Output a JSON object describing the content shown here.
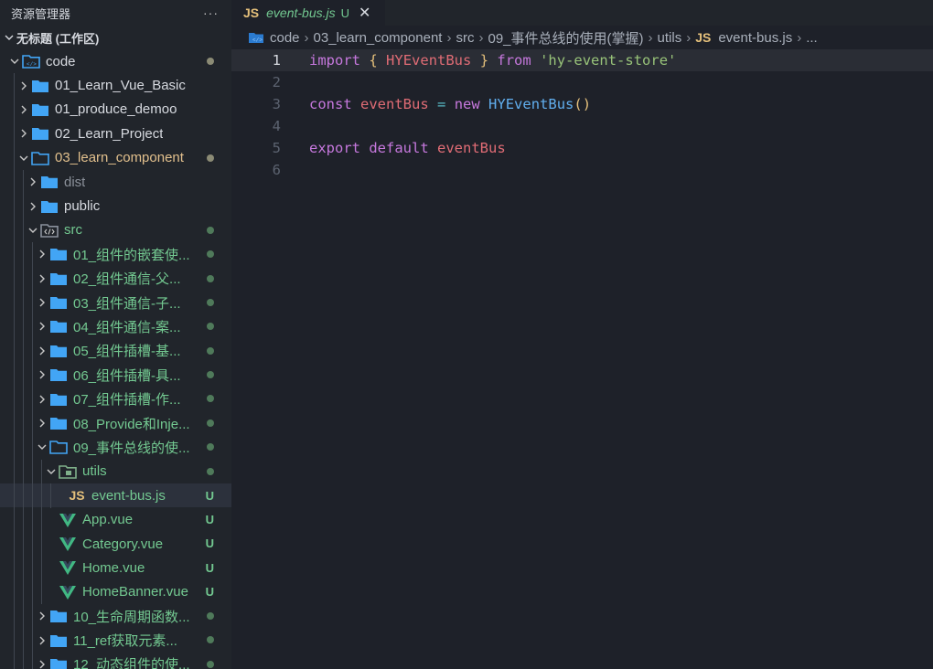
{
  "explorer": {
    "title": "资源管理器",
    "more": "···",
    "workspace": "无标题 (工作区)",
    "rows": [
      {
        "label": "code",
        "depth": 0,
        "open": true,
        "icon": "root",
        "color": "#d7dae0",
        "deco": "dot-gray"
      },
      {
        "label": "01_Learn_Vue_Basic",
        "depth": 1,
        "open": false,
        "icon": "folder",
        "color": "#d7dae0",
        "deco": ""
      },
      {
        "label": "01_produce_demoo",
        "depth": 1,
        "open": false,
        "icon": "folder",
        "color": "#d7dae0",
        "deco": ""
      },
      {
        "label": "02_Learn_Project",
        "depth": 1,
        "open": false,
        "icon": "folder",
        "color": "#d7dae0",
        "deco": ""
      },
      {
        "label": "03_learn_component",
        "depth": 1,
        "open": true,
        "icon": "folder-open",
        "color": "#e2c08d",
        "deco": "dot-gray"
      },
      {
        "label": "dist",
        "depth": 2,
        "open": false,
        "icon": "folder",
        "color": "#8b919a",
        "deco": ""
      },
      {
        "label": "public",
        "depth": 2,
        "open": false,
        "icon": "folder",
        "color": "#d7dae0",
        "deco": ""
      },
      {
        "label": "src",
        "depth": 2,
        "open": true,
        "icon": "src",
        "color": "#73c991",
        "deco": "dot-green"
      },
      {
        "label": "01_组件的嵌套使...",
        "depth": 3,
        "open": false,
        "icon": "folder",
        "color": "#73c991",
        "deco": "dot-green"
      },
      {
        "label": "02_组件通信-父...",
        "depth": 3,
        "open": false,
        "icon": "folder",
        "color": "#73c991",
        "deco": "dot-green"
      },
      {
        "label": "03_组件通信-子...",
        "depth": 3,
        "open": false,
        "icon": "folder",
        "color": "#73c991",
        "deco": "dot-green"
      },
      {
        "label": "04_组件通信-案...",
        "depth": 3,
        "open": false,
        "icon": "folder",
        "color": "#73c991",
        "deco": "dot-green"
      },
      {
        "label": "05_组件插槽-基...",
        "depth": 3,
        "open": false,
        "icon": "folder",
        "color": "#73c991",
        "deco": "dot-green"
      },
      {
        "label": "06_组件插槽-具...",
        "depth": 3,
        "open": false,
        "icon": "folder",
        "color": "#73c991",
        "deco": "dot-green"
      },
      {
        "label": "07_组件插槽-作...",
        "depth": 3,
        "open": false,
        "icon": "folder",
        "color": "#73c991",
        "deco": "dot-green"
      },
      {
        "label": "08_Provide和Inje...",
        "depth": 3,
        "open": false,
        "icon": "folder",
        "color": "#73c991",
        "deco": "dot-green"
      },
      {
        "label": "09_事件总线的使...",
        "depth": 3,
        "open": true,
        "icon": "folder-open",
        "color": "#73c991",
        "deco": "dot-green"
      },
      {
        "label": "utils",
        "depth": 4,
        "open": true,
        "icon": "utils",
        "color": "#73c991",
        "deco": "dot-green"
      },
      {
        "label": "event-bus.js",
        "depth": 5,
        "icon": "js",
        "color": "#73c991",
        "deco": "U",
        "selected": true
      },
      {
        "label": "App.vue",
        "depth": 4,
        "icon": "vue",
        "color": "#73c991",
        "deco": "U"
      },
      {
        "label": "Category.vue",
        "depth": 4,
        "icon": "vue",
        "color": "#73c991",
        "deco": "U"
      },
      {
        "label": "Home.vue",
        "depth": 4,
        "icon": "vue",
        "color": "#73c991",
        "deco": "U"
      },
      {
        "label": "HomeBanner.vue",
        "depth": 4,
        "icon": "vue",
        "color": "#73c991",
        "deco": "U"
      },
      {
        "label": "10_生命周期函数...",
        "depth": 3,
        "open": false,
        "icon": "folder",
        "color": "#73c991",
        "deco": "dot-green"
      },
      {
        "label": "11_ref获取元素...",
        "depth": 3,
        "open": false,
        "icon": "folder",
        "color": "#73c991",
        "deco": "dot-green"
      },
      {
        "label": "12_动态组件的使...",
        "depth": 3,
        "open": false,
        "icon": "folder",
        "color": "#73c991",
        "deco": "dot-green"
      }
    ]
  },
  "tab": {
    "icon": "JS",
    "name": "event-bus.js",
    "status": "U",
    "close": "✕"
  },
  "breadcrumb": {
    "items": [
      "code",
      "03_learn_component",
      "src",
      "09_事件总线的使用(掌握)",
      "utils"
    ],
    "file_icon": "JS",
    "file": "event-bus.js",
    "tail": "..."
  },
  "editor": {
    "active_line": 1,
    "lines": [
      {
        "num": "1",
        "tokens": [
          [
            "kw",
            "import"
          ],
          [
            "t",
            " "
          ],
          [
            "br",
            "{"
          ],
          [
            "t",
            " "
          ],
          [
            "vr",
            "HYEventBus"
          ],
          [
            "t",
            " "
          ],
          [
            "br",
            "}"
          ],
          [
            "t",
            " "
          ],
          [
            "kw",
            "from"
          ],
          [
            "t",
            " "
          ],
          [
            "str",
            "'hy-event-store'"
          ]
        ]
      },
      {
        "num": "2",
        "tokens": []
      },
      {
        "num": "3",
        "tokens": [
          [
            "kw",
            "const"
          ],
          [
            "t",
            " "
          ],
          [
            "vr",
            "eventBus"
          ],
          [
            "t",
            " "
          ],
          [
            "op",
            "="
          ],
          [
            "t",
            " "
          ],
          [
            "kw",
            "new"
          ],
          [
            "t",
            " "
          ],
          [
            "fn",
            "HYEventBus"
          ],
          [
            "br",
            "()"
          ]
        ]
      },
      {
        "num": "4",
        "tokens": []
      },
      {
        "num": "5",
        "tokens": [
          [
            "kw",
            "export"
          ],
          [
            "t",
            " "
          ],
          [
            "kw",
            "default"
          ],
          [
            "t",
            " "
          ],
          [
            "vr",
            "eventBus"
          ]
        ]
      },
      {
        "num": "6",
        "tokens": []
      }
    ]
  },
  "colors": {
    "folder": "#42a5f5",
    "status_green": "#73c991",
    "status_gray": "#8b8b75",
    "vue": "#41b883",
    "js": "#e5c07b"
  }
}
